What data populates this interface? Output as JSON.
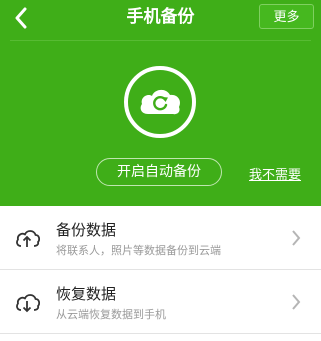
{
  "header": {
    "title": "手机备份",
    "more_label": "更多",
    "auto_backup_label": "开启自动备份",
    "no_need_label": "我不需要",
    "back_icon": "back-chevron-icon",
    "center_icon": "cloud-sync-icon"
  },
  "colors": {
    "header_green": "#3fae18",
    "white": "#ffffff"
  },
  "list": {
    "items": [
      {
        "title": "备份数据",
        "subtitle": "将联系人，照片等数据备份到云端",
        "icon": "cloud-upload-icon"
      },
      {
        "title": "恢复数据",
        "subtitle": "从云端恢复数据到手机",
        "icon": "cloud-download-icon"
      }
    ]
  }
}
